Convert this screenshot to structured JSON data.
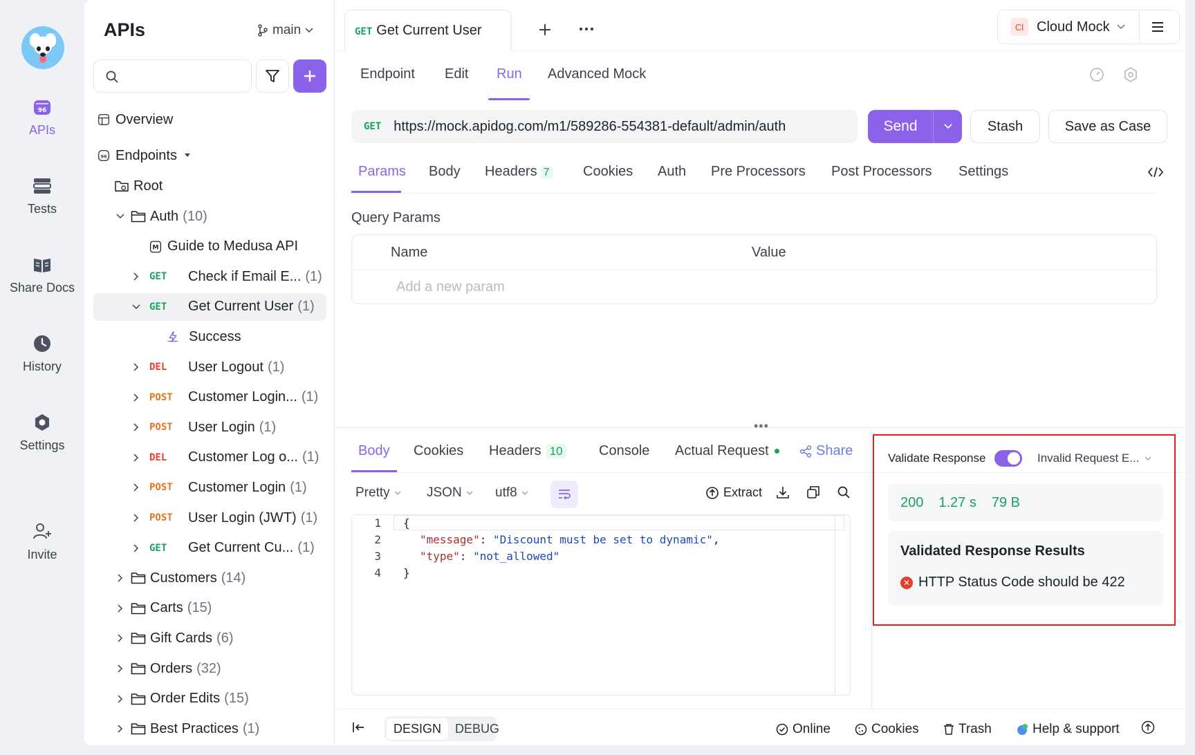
{
  "rail": {
    "items": [
      {
        "label": "APIs",
        "icon": "apis-icon",
        "active": true
      },
      {
        "label": "Tests",
        "icon": "tests-icon"
      },
      {
        "label": "Share Docs",
        "icon": "share-docs-icon"
      },
      {
        "label": "History",
        "icon": "history-icon"
      },
      {
        "label": "Settings",
        "icon": "settings-icon"
      },
      {
        "label": "Invite",
        "icon": "invite-icon"
      }
    ]
  },
  "sidebar": {
    "title": "APIs",
    "branch": "main",
    "overview": "Overview",
    "endpoints": "Endpoints",
    "root": "Root",
    "tree": [
      {
        "type": "folder",
        "label": "Auth",
        "count": "(10)",
        "expanded": true
      },
      {
        "type": "doc",
        "label": "Guide to Medusa API"
      },
      {
        "type": "endpoint",
        "method": "GET",
        "label": "Check if Email E...",
        "count": "(1)"
      },
      {
        "type": "endpoint",
        "method": "GET",
        "label": "Get Current User",
        "count": "(1)",
        "selected": true,
        "expanded": true
      },
      {
        "type": "case",
        "label": "Success"
      },
      {
        "type": "endpoint",
        "method": "DEL",
        "label": "User Logout",
        "count": "(1)"
      },
      {
        "type": "endpoint",
        "method": "POST",
        "label": "Customer Login...",
        "count": "(1)"
      },
      {
        "type": "endpoint",
        "method": "POST",
        "label": "User Login",
        "count": "(1)"
      },
      {
        "type": "endpoint",
        "method": "DEL",
        "label": "Customer Log o...",
        "count": "(1)"
      },
      {
        "type": "endpoint",
        "method": "POST",
        "label": "Customer Login",
        "count": "(1)"
      },
      {
        "type": "endpoint",
        "method": "POST",
        "label": "User Login (JWT)",
        "count": "(1)"
      },
      {
        "type": "endpoint",
        "method": "GET",
        "label": "Get Current Cu...",
        "count": "(1)"
      },
      {
        "type": "folder",
        "label": "Customers",
        "count": "(14)"
      },
      {
        "type": "folder",
        "label": "Carts",
        "count": "(15)"
      },
      {
        "type": "folder",
        "label": "Gift Cards",
        "count": "(6)"
      },
      {
        "type": "folder",
        "label": "Orders",
        "count": "(32)"
      },
      {
        "type": "folder",
        "label": "Order Edits",
        "count": "(15)"
      },
      {
        "type": "folder",
        "label": "Best Practices",
        "count": "(1)"
      }
    ]
  },
  "main": {
    "tab": {
      "method": "GET",
      "title": "Get Current User"
    },
    "env": {
      "badge": "Cl",
      "label": "Cloud Mock"
    },
    "subtabs": [
      "Endpoint",
      "Edit",
      "Run",
      "Advanced Mock"
    ],
    "url": {
      "method": "GET",
      "value": "https://mock.apidog.com/m1/589286-554381-default/admin/auth"
    },
    "send": "Send",
    "stash": "Stash",
    "save_case": "Save as Case",
    "param_tabs": [
      {
        "label": "Params"
      },
      {
        "label": "Body"
      },
      {
        "label": "Headers",
        "num": "7"
      },
      {
        "label": "Cookies"
      },
      {
        "label": "Auth"
      },
      {
        "label": "Pre Processors"
      },
      {
        "label": "Post Processors"
      },
      {
        "label": "Settings"
      }
    ],
    "query": {
      "title": "Query Params",
      "col_name": "Name",
      "col_value": "Value",
      "placeholder": "Add a new param"
    }
  },
  "response": {
    "tabs": [
      {
        "label": "Body"
      },
      {
        "label": "Cookies"
      },
      {
        "label": "Headers",
        "num": "10"
      },
      {
        "label": "Console"
      },
      {
        "label": "Actual Request"
      }
    ],
    "share": "Share",
    "format": {
      "pretty": "Pretty",
      "json": "JSON",
      "encoding": "utf8"
    },
    "tools": {
      "extract": "Extract"
    },
    "code": {
      "lines": [
        "1",
        "2",
        "3",
        "4"
      ],
      "open": "{",
      "key1": "\"message\"",
      "val1": "\"Discount must be set to dynamic\"",
      "key2": "\"type\"",
      "val2": "\"not_allowed\"",
      "close": "}"
    },
    "validate": {
      "label": "Validate Response",
      "enabled": true,
      "select": "Invalid Request E...",
      "status": "200",
      "time": "1.27 s",
      "size": "79 B",
      "results_title": "Validated Response Results",
      "error": "HTTP Status Code should be 422"
    }
  },
  "footer": {
    "design": "DESIGN",
    "debug": "DEBUG",
    "online": "Online",
    "cookies": "Cookies",
    "trash": "Trash",
    "help": "Help & support"
  },
  "colors": {
    "accent": "#8b63ea",
    "get": "#17a35d",
    "del": "#e5402b",
    "post": "#e8731f",
    "highlight": "#e0201c"
  }
}
